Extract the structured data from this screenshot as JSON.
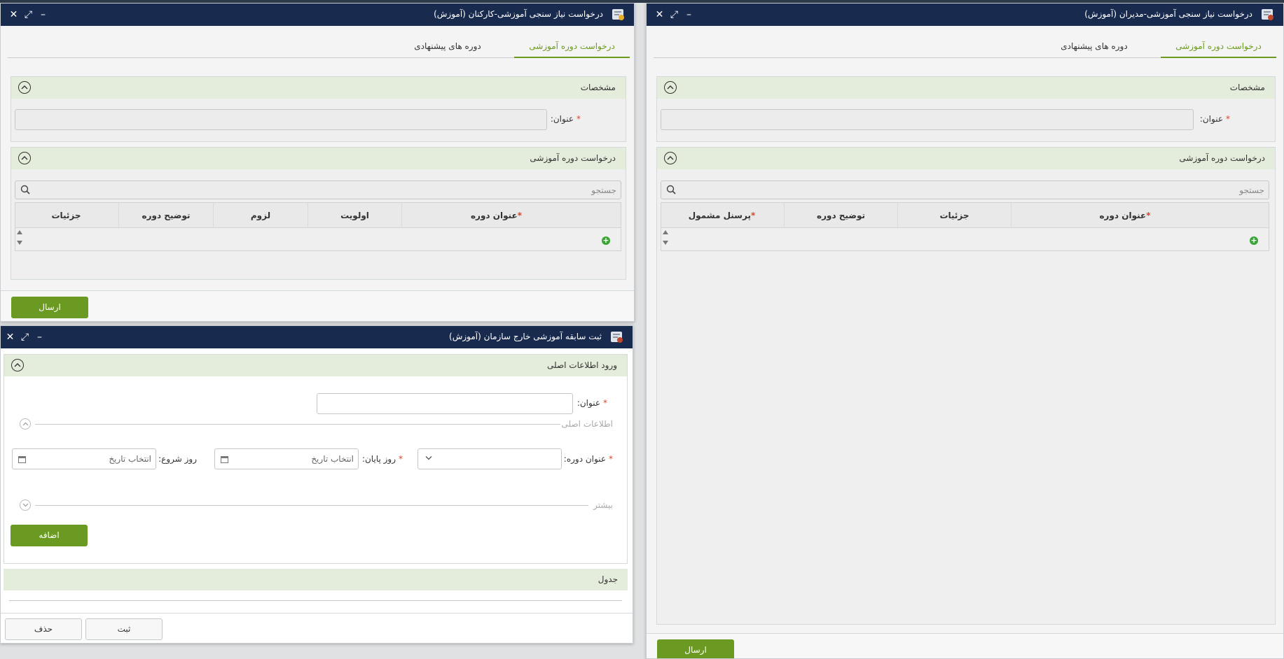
{
  "win_staff": {
    "title": "درخواست نیاز سنجی آموزشی-کارکنان (آموزش)",
    "tabs": [
      "درخواست دوره آموزشی",
      "دوره های پیشنهادی"
    ],
    "spec_panel": {
      "title": "مشخصات",
      "field_label": "عنوان:"
    },
    "request_panel": {
      "title": "درخواست دوره آموزشی",
      "search_placeholder": "جستجو",
      "columns": [
        "عنوان دوره",
        "اولویت",
        "لزوم",
        "توضیح دوره",
        "جزئیات"
      ]
    },
    "send_button": "ارسال"
  },
  "win_managers": {
    "title": "درخواست نیاز سنجی آموزشی-مدیران (آموزش)",
    "tabs": [
      "درخواست دوره آموزشی",
      "دوره های پیشنهادی"
    ],
    "spec_panel": {
      "title": "مشخصات",
      "field_label": "عنوان:"
    },
    "request_panel": {
      "title": "درخواست دوره آموزشی",
      "search_placeholder": "جستجو",
      "columns": [
        "عنوان دوره",
        "جزئیات",
        "توضیح دوره",
        "پرسنل مشمول"
      ]
    },
    "send_button": "ارسال"
  },
  "win_history": {
    "title": "ثبت سابقه آموزشی خارج سازمان (آموزش)",
    "main_panel": {
      "title": "ورود اطلاعات اصلی",
      "title_label": "عنوان:",
      "section_basic": "اطلاعات اصلی",
      "course_title_label": "عنوان دوره:",
      "end_day_label": "روز پایان:",
      "start_day_label": "روز شروع:",
      "date_placeholder": "انتخاب تاریخ",
      "section_more": "بیشتر",
      "add_button": "اضافه"
    },
    "table_panel": {
      "title": "جدول"
    },
    "save_button": "ثبت",
    "delete_button": "حذف"
  },
  "window_controls": {
    "close": "✕",
    "maximize": "⤢",
    "minimize": "–"
  },
  "colors": {
    "titlebar": "#182a4e",
    "accent": "#6b9a22",
    "panel_header": "#e4ecdb",
    "required": "#d9462a"
  },
  "icons": [
    "search-icon",
    "calendar-icon",
    "chevron-down-icon",
    "collapse-up-icon",
    "plus-icon",
    "close-icon",
    "maximize-icon",
    "minimize-icon",
    "app-icon"
  ]
}
